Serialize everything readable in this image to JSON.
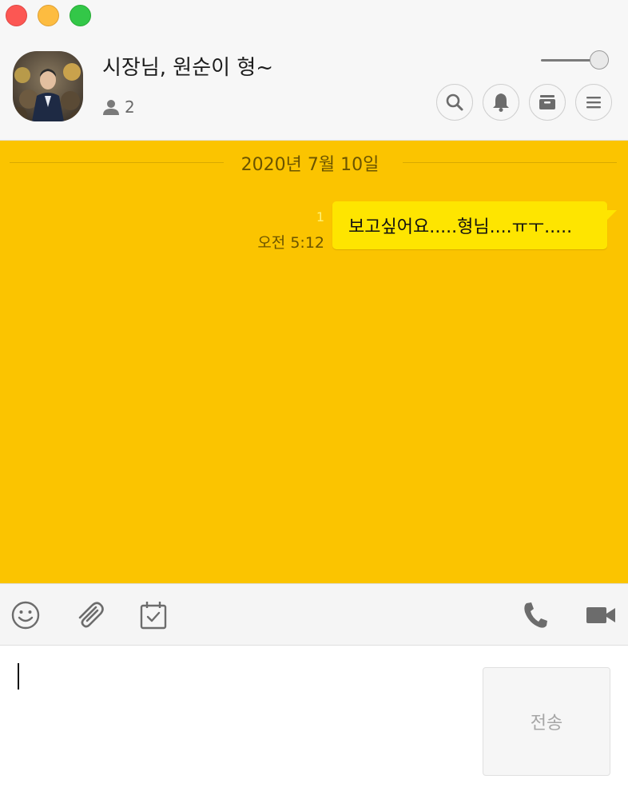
{
  "header": {
    "title": "시장님, 원순이 형~",
    "member_count": "2"
  },
  "chat": {
    "date": "2020년 7월 10일",
    "messages": [
      {
        "text": "보고싶어요.....형님....ㅠㅜ.....",
        "time": "오전 5:12",
        "unread": "1",
        "sender": "me"
      }
    ]
  },
  "input": {
    "value": "",
    "send_label": "전송"
  },
  "colors": {
    "chat_background": "#fbc400",
    "my_bubble": "#fee500",
    "header_background": "#f7f7f7"
  },
  "icons": {
    "header_buttons": [
      "search-icon",
      "bell-icon",
      "archive-icon",
      "menu-icon"
    ],
    "toolbar_left": [
      "emoji-icon",
      "paperclip-icon",
      "calendar-check-icon"
    ],
    "toolbar_right": [
      "phone-icon",
      "video-camera-icon"
    ]
  }
}
